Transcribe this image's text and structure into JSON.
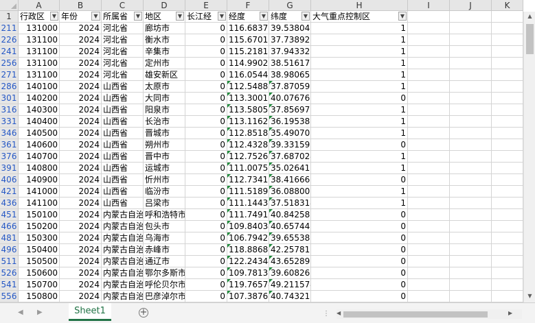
{
  "sheet": {
    "columns": [
      "A",
      "B",
      "C",
      "D",
      "E",
      "F",
      "G",
      "H",
      "I",
      "J",
      "K"
    ],
    "header_row_number": "1",
    "headers": [
      "行政区",
      "年份",
      "所属省",
      "地区",
      "长江经",
      "经度",
      "纬度",
      "大气重点控制区"
    ],
    "rows": [
      {
        "rn": "211",
        "a": "131000",
        "b": "2024",
        "c": "河北省",
        "d": "廊坊市",
        "e": "0",
        "f": "116.68375",
        "g": "39.538047",
        "h": "1"
      },
      {
        "rn": "226",
        "a": "131100",
        "b": "2024",
        "c": "河北省",
        "d": "衡水市",
        "e": "0",
        "f": "115.67017",
        "g": "37.738920",
        "h": "1"
      },
      {
        "rn": "241",
        "a": "131100",
        "b": "2024",
        "c": "河北省",
        "d": "辛集市",
        "e": "0",
        "f": "115.2181",
        "g": "37.94332",
        "h": "1"
      },
      {
        "rn": "256",
        "a": "131100",
        "b": "2024",
        "c": "河北省",
        "d": "定州市",
        "e": "0",
        "f": "114.9902",
        "g": "38.51617",
        "h": "1"
      },
      {
        "rn": "271",
        "a": "131100",
        "b": "2024",
        "c": "河北省",
        "d": "雄安新区",
        "e": "0",
        "f": "116.0544",
        "g": "38.98065",
        "h": "1"
      },
      {
        "rn": "286",
        "a": "140100",
        "b": "2024",
        "c": "山西省",
        "d": "太原市",
        "e": "0",
        "f": "112.54887",
        "g": "37.870590",
        "h": "1"
      },
      {
        "rn": "301",
        "a": "140200",
        "b": "2024",
        "c": "山西省",
        "d": "大同市",
        "e": "0",
        "f": "113.30012",
        "g": "40.076762",
        "h": "0"
      },
      {
        "rn": "316",
        "a": "140300",
        "b": "2024",
        "c": "山西省",
        "d": "阳泉市",
        "e": "0",
        "f": "113.58051",
        "g": "37.856971",
        "h": "1"
      },
      {
        "rn": "331",
        "a": "140400",
        "b": "2024",
        "c": "山西省",
        "d": "长治市",
        "e": "0",
        "f": "113.11625",
        "g": "36.195386",
        "h": "1"
      },
      {
        "rn": "346",
        "a": "140500",
        "b": "2024",
        "c": "山西省",
        "d": "晋城市",
        "e": "0",
        "f": "112.85183",
        "g": "35.490701",
        "h": "1"
      },
      {
        "rn": "361",
        "a": "140600",
        "b": "2024",
        "c": "山西省",
        "d": "朔州市",
        "e": "0",
        "f": "112.43282",
        "g": "39.331595",
        "h": "0"
      },
      {
        "rn": "376",
        "a": "140700",
        "b": "2024",
        "c": "山西省",
        "d": "晋中市",
        "e": "0",
        "f": "112.75269",
        "g": "37.687024",
        "h": "1"
      },
      {
        "rn": "391",
        "a": "140800",
        "b": "2024",
        "c": "山西省",
        "d": "运城市",
        "e": "0",
        "f": "111.00752",
        "g": "35.026412",
        "h": "1"
      },
      {
        "rn": "406",
        "a": "140900",
        "b": "2024",
        "c": "山西省",
        "d": "忻州市",
        "e": "0",
        "f": "112.73417",
        "g": "38.416663",
        "h": "0"
      },
      {
        "rn": "421",
        "a": "141000",
        "b": "2024",
        "c": "山西省",
        "d": "临汾市",
        "e": "0",
        "f": "111.51897",
        "g": "36.088005",
        "h": "1"
      },
      {
        "rn": "436",
        "a": "141100",
        "b": "2024",
        "c": "山西省",
        "d": "吕梁市",
        "e": "0",
        "f": "111.14431",
        "g": "37.518314",
        "h": "1"
      },
      {
        "rn": "451",
        "a": "150100",
        "b": "2024",
        "c": "内蒙古自治",
        "d": "呼和浩特市",
        "e": "0",
        "f": "111.74918",
        "g": "40.842585",
        "h": "0"
      },
      {
        "rn": "466",
        "a": "150200",
        "b": "2024",
        "c": "内蒙古自治",
        "d": "包头市",
        "e": "0",
        "f": "109.84034",
        "g": "40.657449",
        "h": "0"
      },
      {
        "rn": "481",
        "a": "150300",
        "b": "2024",
        "c": "内蒙古自治",
        "d": "乌海市",
        "e": "0",
        "f": "106.79424",
        "g": "39.655388",
        "h": "0"
      },
      {
        "rn": "496",
        "a": "150400",
        "b": "2024",
        "c": "内蒙古自治",
        "d": "赤峰市",
        "e": "0",
        "f": "118.88685",
        "g": "42.257817",
        "h": "0"
      },
      {
        "rn": "511",
        "a": "150500",
        "b": "2024",
        "c": "内蒙古自治",
        "d": "通辽市",
        "e": "0",
        "f": "122.24344",
        "g": "43.652890",
        "h": "0"
      },
      {
        "rn": "526",
        "a": "150600",
        "b": "2024",
        "c": "内蒙古自治",
        "d": "鄂尔多斯市",
        "e": "0",
        "f": "109.78132",
        "g": "39.608266",
        "h": "0"
      },
      {
        "rn": "541",
        "a": "150700",
        "b": "2024",
        "c": "内蒙古自治",
        "d": "呼伦贝尔市",
        "e": "0",
        "f": "119.76574",
        "g": "49.211574",
        "h": "0"
      },
      {
        "rn": "556",
        "a": "150800",
        "b": "2024",
        "c": "内蒙古自治",
        "d": "巴彦淖尔市",
        "e": "0",
        "f": "107.38765",
        "g": "40.743213",
        "h": "0"
      }
    ]
  },
  "tabs": {
    "active": "Sheet1",
    "add_label": "+"
  },
  "icons": {
    "filter_active": "filter-icon",
    "dropdown": "dropdown-arrow-icon"
  },
  "colors": {
    "accent": "#217346",
    "rownum": "#2457c5",
    "error_triangle": "#1f8a3b"
  }
}
